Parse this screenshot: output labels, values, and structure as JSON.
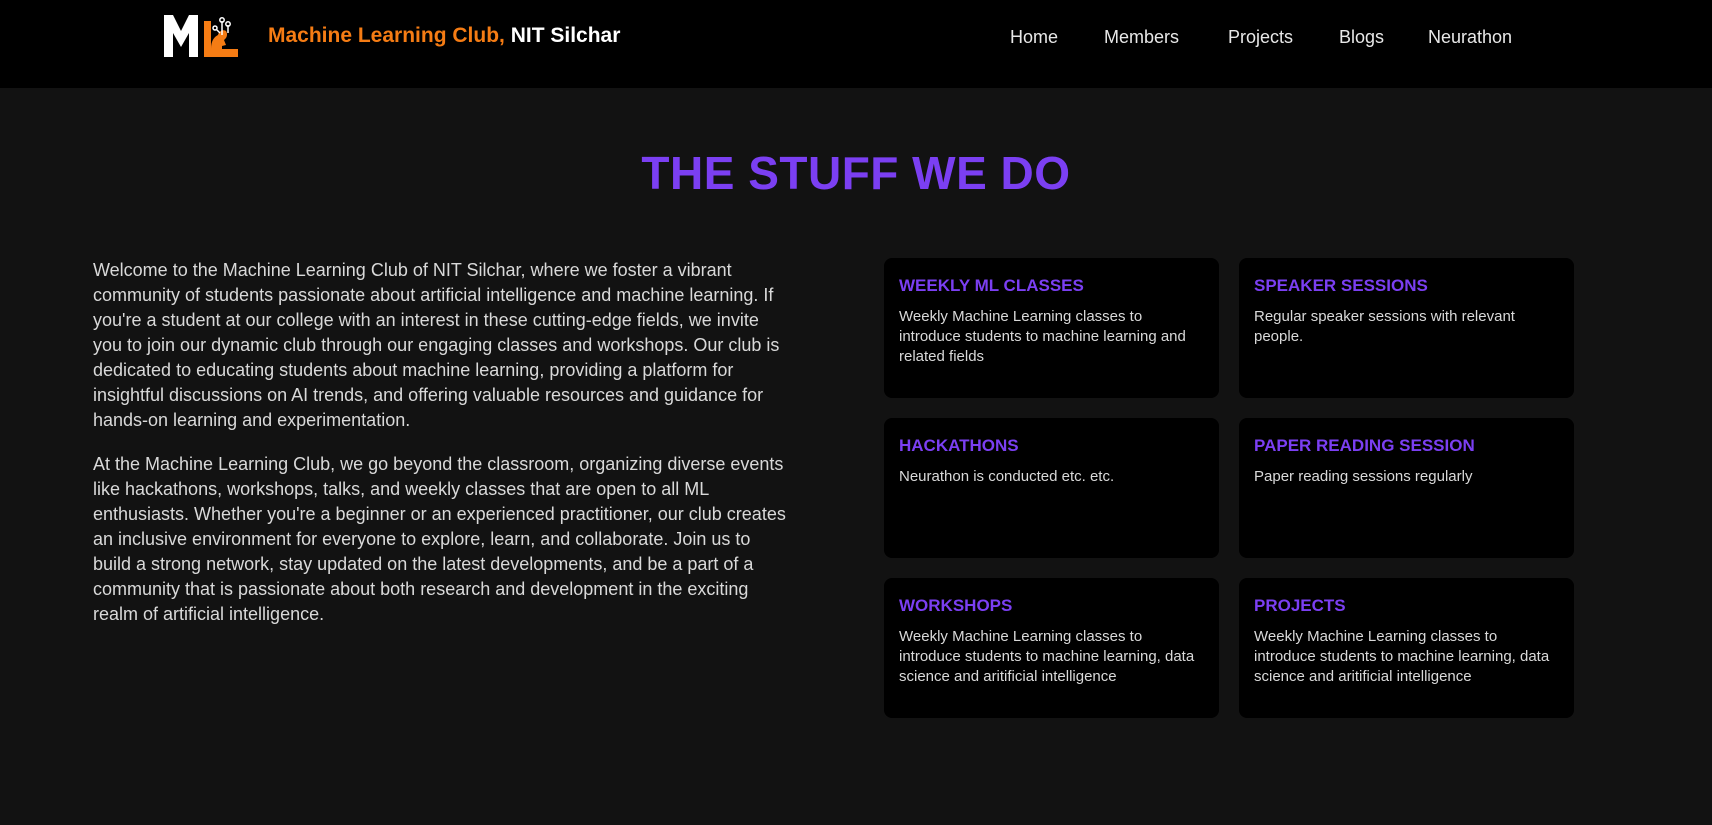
{
  "header": {
    "brand_part1": "Machine Learning Club,",
    "brand_part2": "NIT Silchar",
    "logo_letters": "ML",
    "nav": [
      "Home",
      "Members",
      "Projects",
      "Blogs",
      "Neurathon"
    ]
  },
  "main": {
    "title": "THE STUFF WE DO",
    "paragraphs": [
      "Welcome to the Machine Learning Club of NIT Silchar, where we foster a vibrant community of students passionate about artificial intelligence and machine learning. If you're a student at our college with an interest in these cutting-edge fields, we invite you to join our dynamic club through our engaging classes and workshops. Our club is dedicated to educating students about machine learning, providing a platform for insightful discussions on AI trends, and offering valuable resources and guidance for hands-on learning and experimentation.",
      "At the Machine Learning Club, we go beyond the classroom, organizing diverse events like hackathons, workshops, talks, and weekly classes that are open to all ML enthusiasts. Whether you're a beginner or an experienced practitioner, our club creates an inclusive environment for everyone to explore, learn, and collaborate. Join us to build a strong network, stay updated on the latest developments, and be a part of a community that is passionate about both research and development in the exciting realm of artificial intelligence."
    ],
    "cards": [
      {
        "title": "WEEKLY ML CLASSES",
        "desc": "Weekly Machine Learning classes to introduce students to machine learning and related fields"
      },
      {
        "title": "SPEAKER SESSIONS",
        "desc": "Regular speaker sessions with relevant people."
      },
      {
        "title": "HACKATHONS",
        "desc": "Neurathon is conducted etc. etc."
      },
      {
        "title": "PAPER READING SESSION",
        "desc": "Paper reading sessions regularly"
      },
      {
        "title": "WORKSHOPS",
        "desc": "Weekly Machine Learning classes to introduce students to machine learning, data science and aritificial intelligence"
      },
      {
        "title": "PROJECTS",
        "desc": "Weekly Machine Learning classes to introduce students to machine learning, data science and aritificial intelligence"
      }
    ]
  },
  "colors": {
    "accent_purple": "#7b3ff2",
    "brand_orange": "#f57c14",
    "background": "#121212",
    "card_background": "#000000"
  }
}
